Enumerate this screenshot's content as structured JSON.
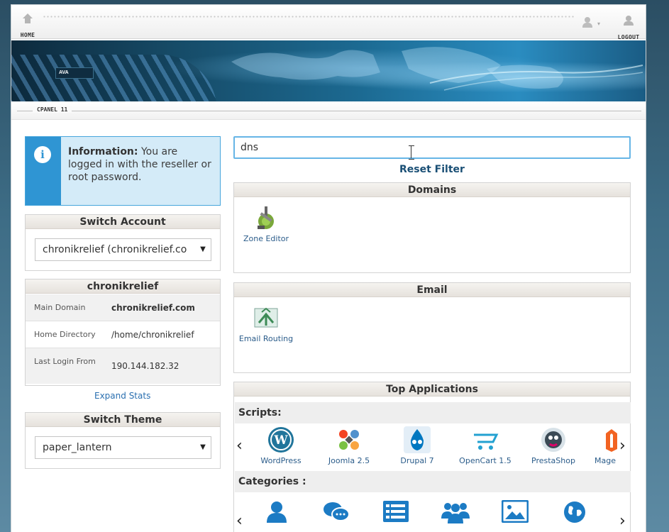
{
  "topbar": {
    "home_label": "HOME",
    "logout_label": "LOGOUT"
  },
  "banner": {
    "logo_text": "AVA",
    "logo_accent": ""
  },
  "subbar": {
    "label": "CPANEL 11"
  },
  "info": {
    "title": "Information:",
    "message": "You are logged in with the reseller or root password."
  },
  "switch_account": {
    "title": "Switch Account",
    "selected": "chronikrelief (chronikrelief.co"
  },
  "account": {
    "title": "chronikrelief",
    "rows": [
      {
        "key": "Main Domain",
        "value": "chronikrelief.com"
      },
      {
        "key": "Home Directory",
        "value": "/home/chronikrelief"
      },
      {
        "key": "Last Login From",
        "value": "190.144.182.32"
      }
    ],
    "expand_label": "Expand Stats"
  },
  "switch_theme": {
    "title": "Switch Theme",
    "selected": "paper_lantern"
  },
  "search": {
    "value": "dns"
  },
  "reset_filter": "Reset Filter",
  "domains": {
    "title": "Domains",
    "items": [
      {
        "label": "Zone Editor",
        "icon": "zone-editor-icon"
      }
    ]
  },
  "email": {
    "title": "Email",
    "items": [
      {
        "label": "Email Routing",
        "icon": "email-routing-icon"
      }
    ]
  },
  "top_apps": {
    "title": "Top Applications",
    "scripts_label": "Scripts:",
    "scripts": [
      {
        "label": "WordPress",
        "icon": "wordpress-icon"
      },
      {
        "label": "Joomla 2.5",
        "icon": "joomla-icon"
      },
      {
        "label": "Drupal 7",
        "icon": "drupal-icon"
      },
      {
        "label": "OpenCart 1.5",
        "icon": "opencart-icon"
      },
      {
        "label": "PrestaShop",
        "icon": "prestashop-icon"
      },
      {
        "label": "Mage",
        "icon": "magento-icon"
      }
    ],
    "categories_label": "Categories :",
    "categories": [
      {
        "label": "",
        "icon": "user-icon"
      },
      {
        "label": "",
        "icon": "chat-icon"
      },
      {
        "label": "",
        "icon": "list-icon"
      },
      {
        "label": "",
        "icon": "group-icon"
      },
      {
        "label": "",
        "icon": "image-icon"
      },
      {
        "label": "",
        "icon": "globe-icon"
      }
    ]
  },
  "colors": {
    "accent_blue": "#2f95d3",
    "info_bg": "#d4ebf8",
    "link": "#2b5c8a",
    "heading_bg": "#e6e2dd"
  }
}
